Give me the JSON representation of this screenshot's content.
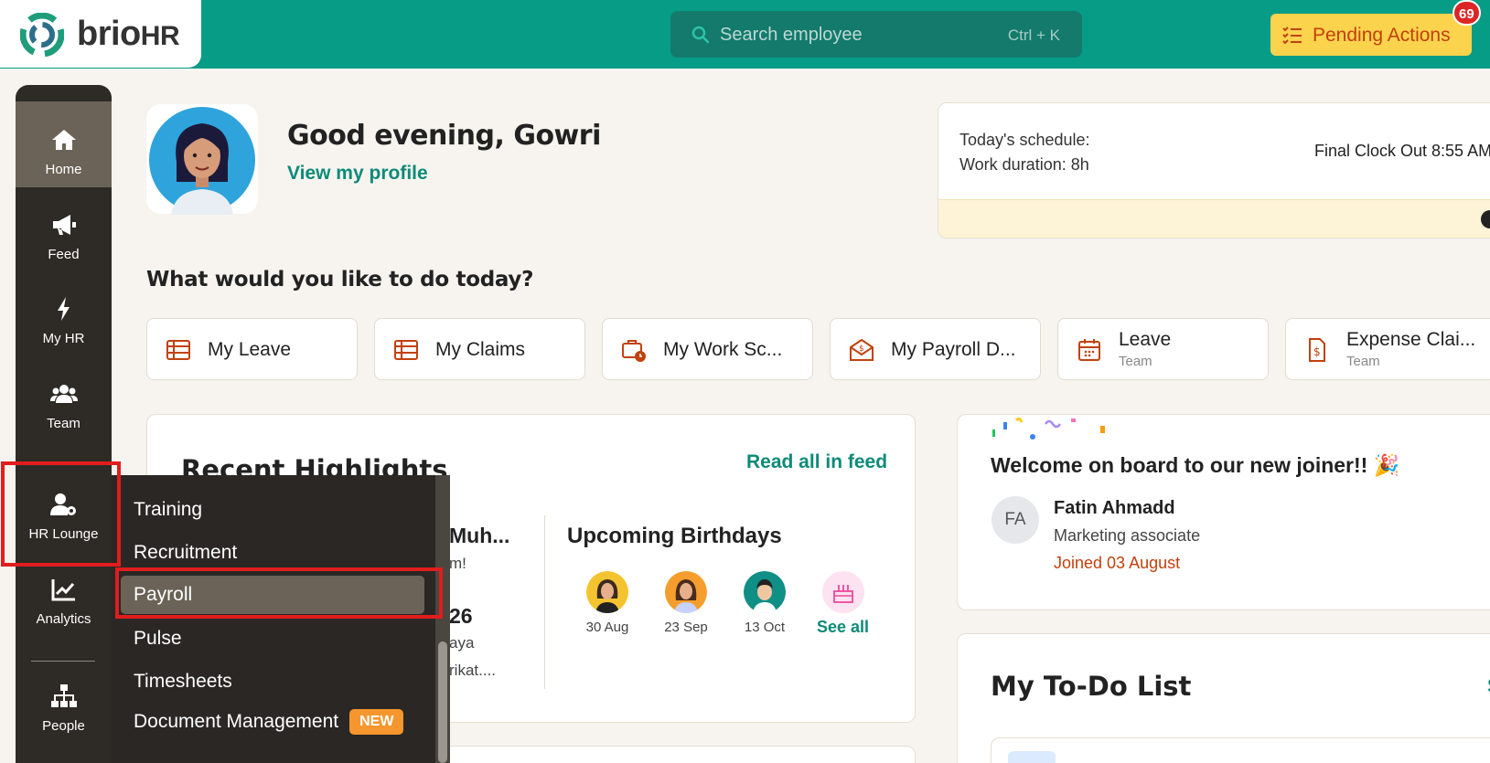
{
  "app": {
    "logo_text": "brio",
    "logo_suffix": "HR"
  },
  "search": {
    "placeholder": "Search employee",
    "shortcut": "Ctrl + K"
  },
  "pending_actions": {
    "label": "Pending Actions",
    "count": "69"
  },
  "sidebar": {
    "items": [
      {
        "label": "Home",
        "icon": "home-icon"
      },
      {
        "label": "Feed",
        "icon": "megaphone-icon"
      },
      {
        "label": "My HR",
        "icon": "bolt-icon"
      },
      {
        "label": "Team",
        "icon": "users-icon"
      },
      {
        "label": "HR Lounge",
        "icon": "user-gear-icon"
      },
      {
        "label": "Analytics",
        "icon": "chart-line-icon"
      },
      {
        "label": "People",
        "icon": "org-chart-icon"
      }
    ]
  },
  "hr_lounge_menu": {
    "items": [
      "Training",
      "Recruitment",
      "Payroll",
      "Pulse",
      "Timesheets",
      "Document Management"
    ],
    "new_tag": "NEW",
    "selected": "Payroll"
  },
  "profile": {
    "greeting": "Good evening, Gowri",
    "view_profile": "View my profile"
  },
  "schedule": {
    "today": "Today's schedule:",
    "duration": "Work duration: 8h",
    "clock_out": "Final Clock Out 8:55 AM"
  },
  "quick_actions": {
    "question": "What would you like to do today?",
    "items": [
      {
        "label": "My Leave",
        "sub": ""
      },
      {
        "label": "My Claims",
        "sub": ""
      },
      {
        "label": "My Work Sc...",
        "sub": ""
      },
      {
        "label": "My Payroll D...",
        "sub": ""
      },
      {
        "label": "Leave",
        "sub": "Team"
      },
      {
        "label": "Expense Clai...",
        "sub": "Team"
      }
    ]
  },
  "highlights": {
    "title": "Recent Highlights",
    "read_all": "Read all in feed",
    "peek": {
      "muh": "Muh...",
      "m": "m!",
      "num": "26",
      "aya": "aya",
      "rik": "rikat...."
    }
  },
  "birthdays": {
    "title": "Upcoming Birthdays",
    "people": [
      {
        "date": "30 Aug"
      },
      {
        "date": "23 Sep"
      },
      {
        "date": "13 Oct"
      }
    ],
    "see_all": "See all"
  },
  "welcome": {
    "title": "Welcome on board to our new joiner!! 🎉",
    "initials": "FA",
    "name": "Fatin Ahmadd",
    "role": "Marketing associate",
    "joined": "Joined 03 August"
  },
  "todo": {
    "title": "My To-Do List",
    "link": "S"
  },
  "colors": {
    "brand_teal": "#069c86",
    "sidebar_dark": "#2e2a25",
    "accent_orange": "#c2410c",
    "highlight_red": "#e11d1d"
  }
}
